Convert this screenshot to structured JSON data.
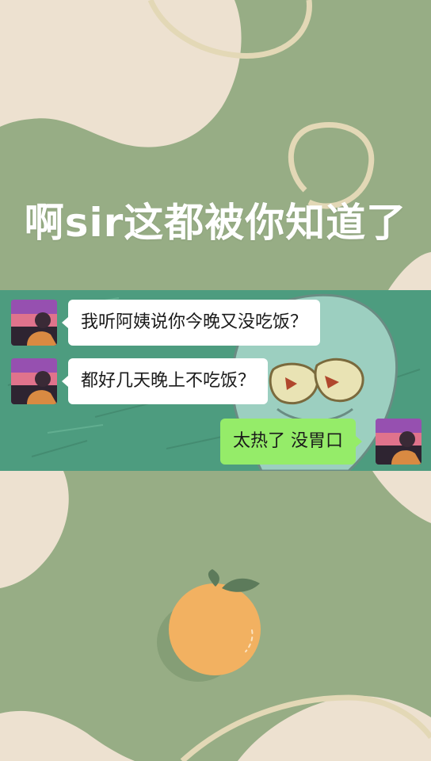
{
  "headline": {
    "text": "啊sir这都被你知道了"
  },
  "chat": {
    "messages": [
      {
        "side": "left",
        "text": "我听阿姨说你今晚又没吃饭？"
      },
      {
        "side": "left",
        "text": "都好几天晚上不吃饭？"
      },
      {
        "side": "right",
        "text": "太热了 没胃口"
      }
    ]
  },
  "colors": {
    "background_green": "#97ad85",
    "cream_shape": "#ede1d0",
    "outline_cream": "#e3d8b6",
    "chat_bg_teal": "#4d9c7f",
    "incoming_bubble": "#ffffff",
    "outgoing_bubble": "#95ec69",
    "orange_fruit": "#f2b161",
    "leaf_green": "#5d7b5b"
  },
  "icons": {
    "avatar_other": "avatar-sunset-photo",
    "avatar_self": "avatar-sunset-photo",
    "decoration": "orange-fruit-icon"
  }
}
